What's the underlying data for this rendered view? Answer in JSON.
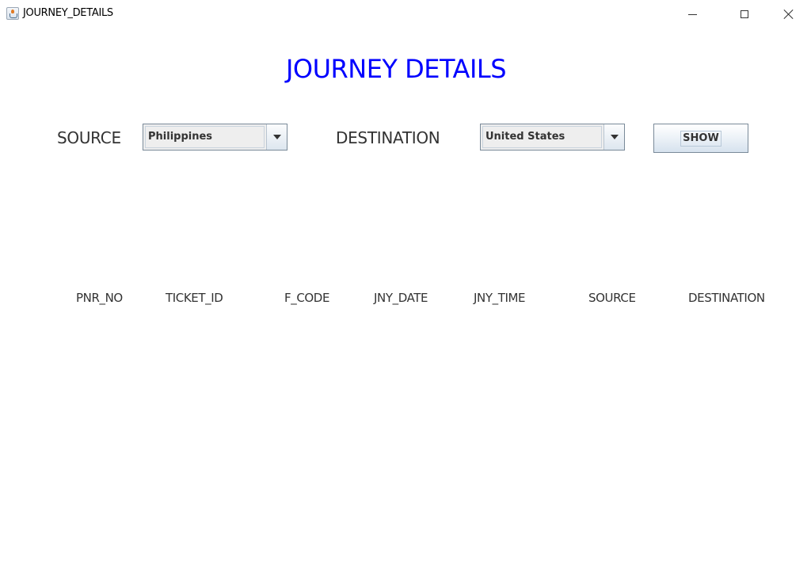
{
  "window": {
    "title": "JOURNEY_DETAILS",
    "icon": "java-app-icon",
    "controls": {
      "minimize": "minimize-icon",
      "maximize": "maximize-icon",
      "close": "close-icon"
    }
  },
  "heading": "JOURNEY DETAILS",
  "colors": {
    "heading": "#0000ff",
    "label": "#333333",
    "background": "#ffffff"
  },
  "form": {
    "source_label": "SOURCE",
    "source_value": "Philippines",
    "destination_label": "DESTINATION",
    "destination_value": "United States",
    "show_button": "SHOW"
  },
  "table": {
    "columns": [
      "PNR_NO",
      "TICKET_ID",
      "F_CODE",
      "JNY_DATE",
      "JNY_TIME",
      "SOURCE",
      "DESTINATION"
    ],
    "rows": []
  }
}
